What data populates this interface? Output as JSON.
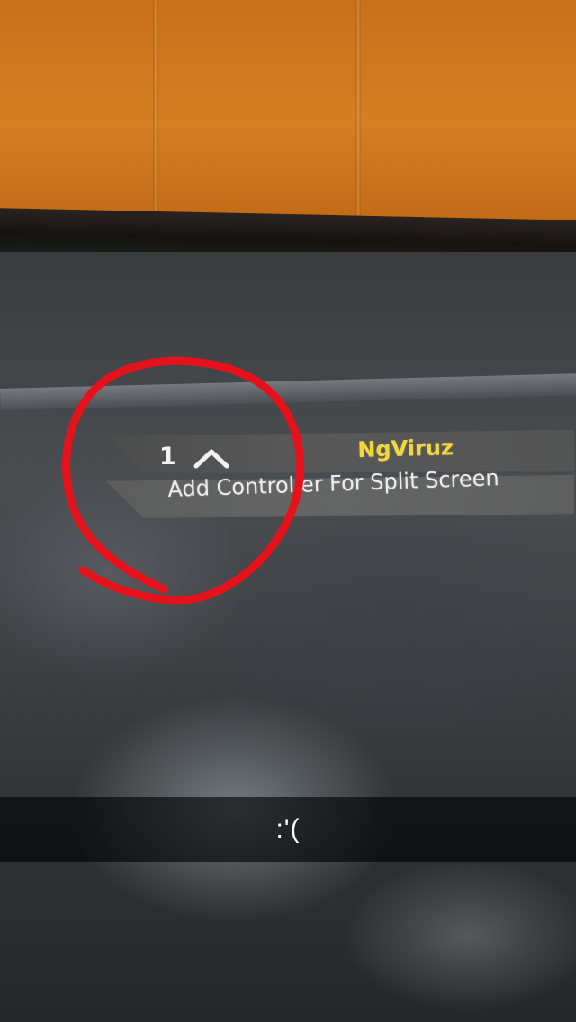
{
  "game_menu": {
    "player_number": "1",
    "chevron_icon": "chevron-up-icon",
    "gamertag": "NgViruz",
    "split_screen_prompt": "Add Controller For Split Screen"
  },
  "caption": {
    "text": ":'("
  },
  "annotation": {
    "red_circle_color": "#e5121b"
  },
  "colors": {
    "gamertag": "#f2d640",
    "wall": "#d07a20"
  }
}
